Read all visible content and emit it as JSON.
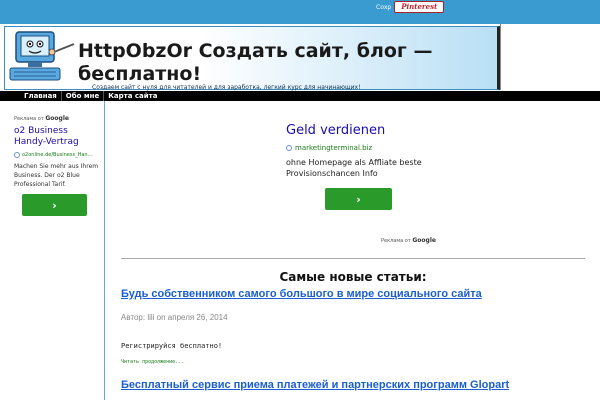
{
  "pinterest": {
    "label": "Сохр",
    "button": "Pinterest"
  },
  "header": {
    "title": "HttpObzOr Создать сайт, блог — бесплатно!",
    "tagline": "Создаем сайт с нуля для читателей и для заработка, легкий курс для начинающих!"
  },
  "nav": {
    "items": [
      "Главная",
      "Обо мне",
      "Карта сайта"
    ]
  },
  "ads_by": {
    "prefix": "Реклама от",
    "brand": "Google"
  },
  "left_ad": {
    "title": "o2 Business Handy-Vertrag",
    "url": "o2online.de/Business_Han...",
    "desc": "Machen Sie mehr aus Ihrem Business. Der o2 Blue Professional Tarif.",
    "button": "›"
  },
  "main_ad": {
    "title": "Geld verdienen",
    "url": "marketingterminal.biz",
    "desc": "ohne Homepage als Affliate beste Provisionschancen Info",
    "button": "›"
  },
  "content": {
    "section_title": "Самые новые статьи:",
    "posts": [
      {
        "title": "Будь собственником самого большого в мире социального сайта",
        "meta": "Автор: lili on апреля 26, 2014",
        "text": "Регистрируйся бесплатно!",
        "read_more": "Читать продолжение..."
      },
      {
        "title": "Бесплатный сервис приема платежей и партнерских программ Glopart"
      }
    ]
  },
  "colors": {
    "accent": "#3a9bd0",
    "link": "#1a5fcf",
    "button": "#2a9a2a"
  }
}
